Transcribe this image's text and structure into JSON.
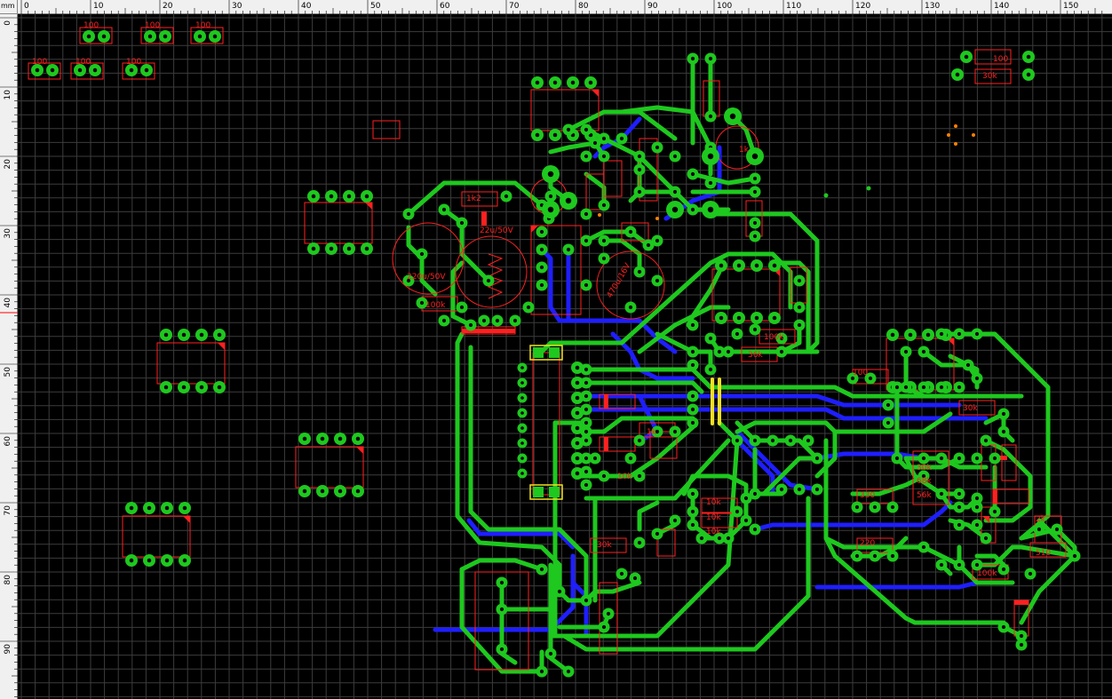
{
  "ruler": {
    "unit": "mm",
    "top_labels": [
      "0",
      "10",
      "20",
      "30",
      "40",
      "50",
      "60",
      "70",
      "80",
      "90",
      "100",
      "110",
      "120",
      "130",
      "140",
      "150"
    ],
    "left_labels": [
      "0",
      "10",
      "20",
      "30",
      "40",
      "50",
      "60",
      "70",
      "80",
      "90"
    ]
  },
  "colors": {
    "background": "#000000",
    "grid": "#3c3c3c",
    "copper_top": "#1ec81e",
    "copper_bottom": "#1e1eff",
    "silkscreen": "#ff2020",
    "bridge": "#f0e020",
    "marker": "#ff8000"
  },
  "component_labels": [
    {
      "key": "r1",
      "text": "100"
    },
    {
      "key": "r2",
      "text": "100"
    },
    {
      "key": "r3",
      "text": "100"
    },
    {
      "key": "r4",
      "text": "100"
    },
    {
      "key": "r5",
      "text": "100"
    },
    {
      "key": "r6",
      "text": "100"
    },
    {
      "key": "r7",
      "text": "100"
    },
    {
      "key": "r8",
      "text": "30k"
    },
    {
      "key": "r9",
      "text": "1k2"
    },
    {
      "key": "r10",
      "text": "1k"
    },
    {
      "key": "r11",
      "text": "100k"
    },
    {
      "key": "r12",
      "text": "10k"
    },
    {
      "key": "r13",
      "text": "10k"
    },
    {
      "key": "r14",
      "text": "10k"
    },
    {
      "key": "r15",
      "text": "30k"
    },
    {
      "key": "r16",
      "text": "1k"
    },
    {
      "key": "r17",
      "text": "36k"
    },
    {
      "key": "r18",
      "text": "100k"
    },
    {
      "key": "r19",
      "text": "100"
    },
    {
      "key": "r20",
      "text": "330"
    },
    {
      "key": "r21",
      "text": "220"
    },
    {
      "key": "r22",
      "text": "68k"
    },
    {
      "key": "r23",
      "text": "56k"
    },
    {
      "key": "r24",
      "text": "30k"
    },
    {
      "key": "r25",
      "text": "100k"
    },
    {
      "key": "r26",
      "text": "510"
    },
    {
      "key": "r27",
      "text": "30k"
    },
    {
      "key": "r28",
      "text": "10k"
    },
    {
      "key": "r29",
      "text": "2k"
    },
    {
      "key": "c1",
      "text": "220u/50V"
    },
    {
      "key": "c2",
      "text": "22u/50V"
    },
    {
      "key": "c3",
      "text": "470u/16V"
    }
  ]
}
